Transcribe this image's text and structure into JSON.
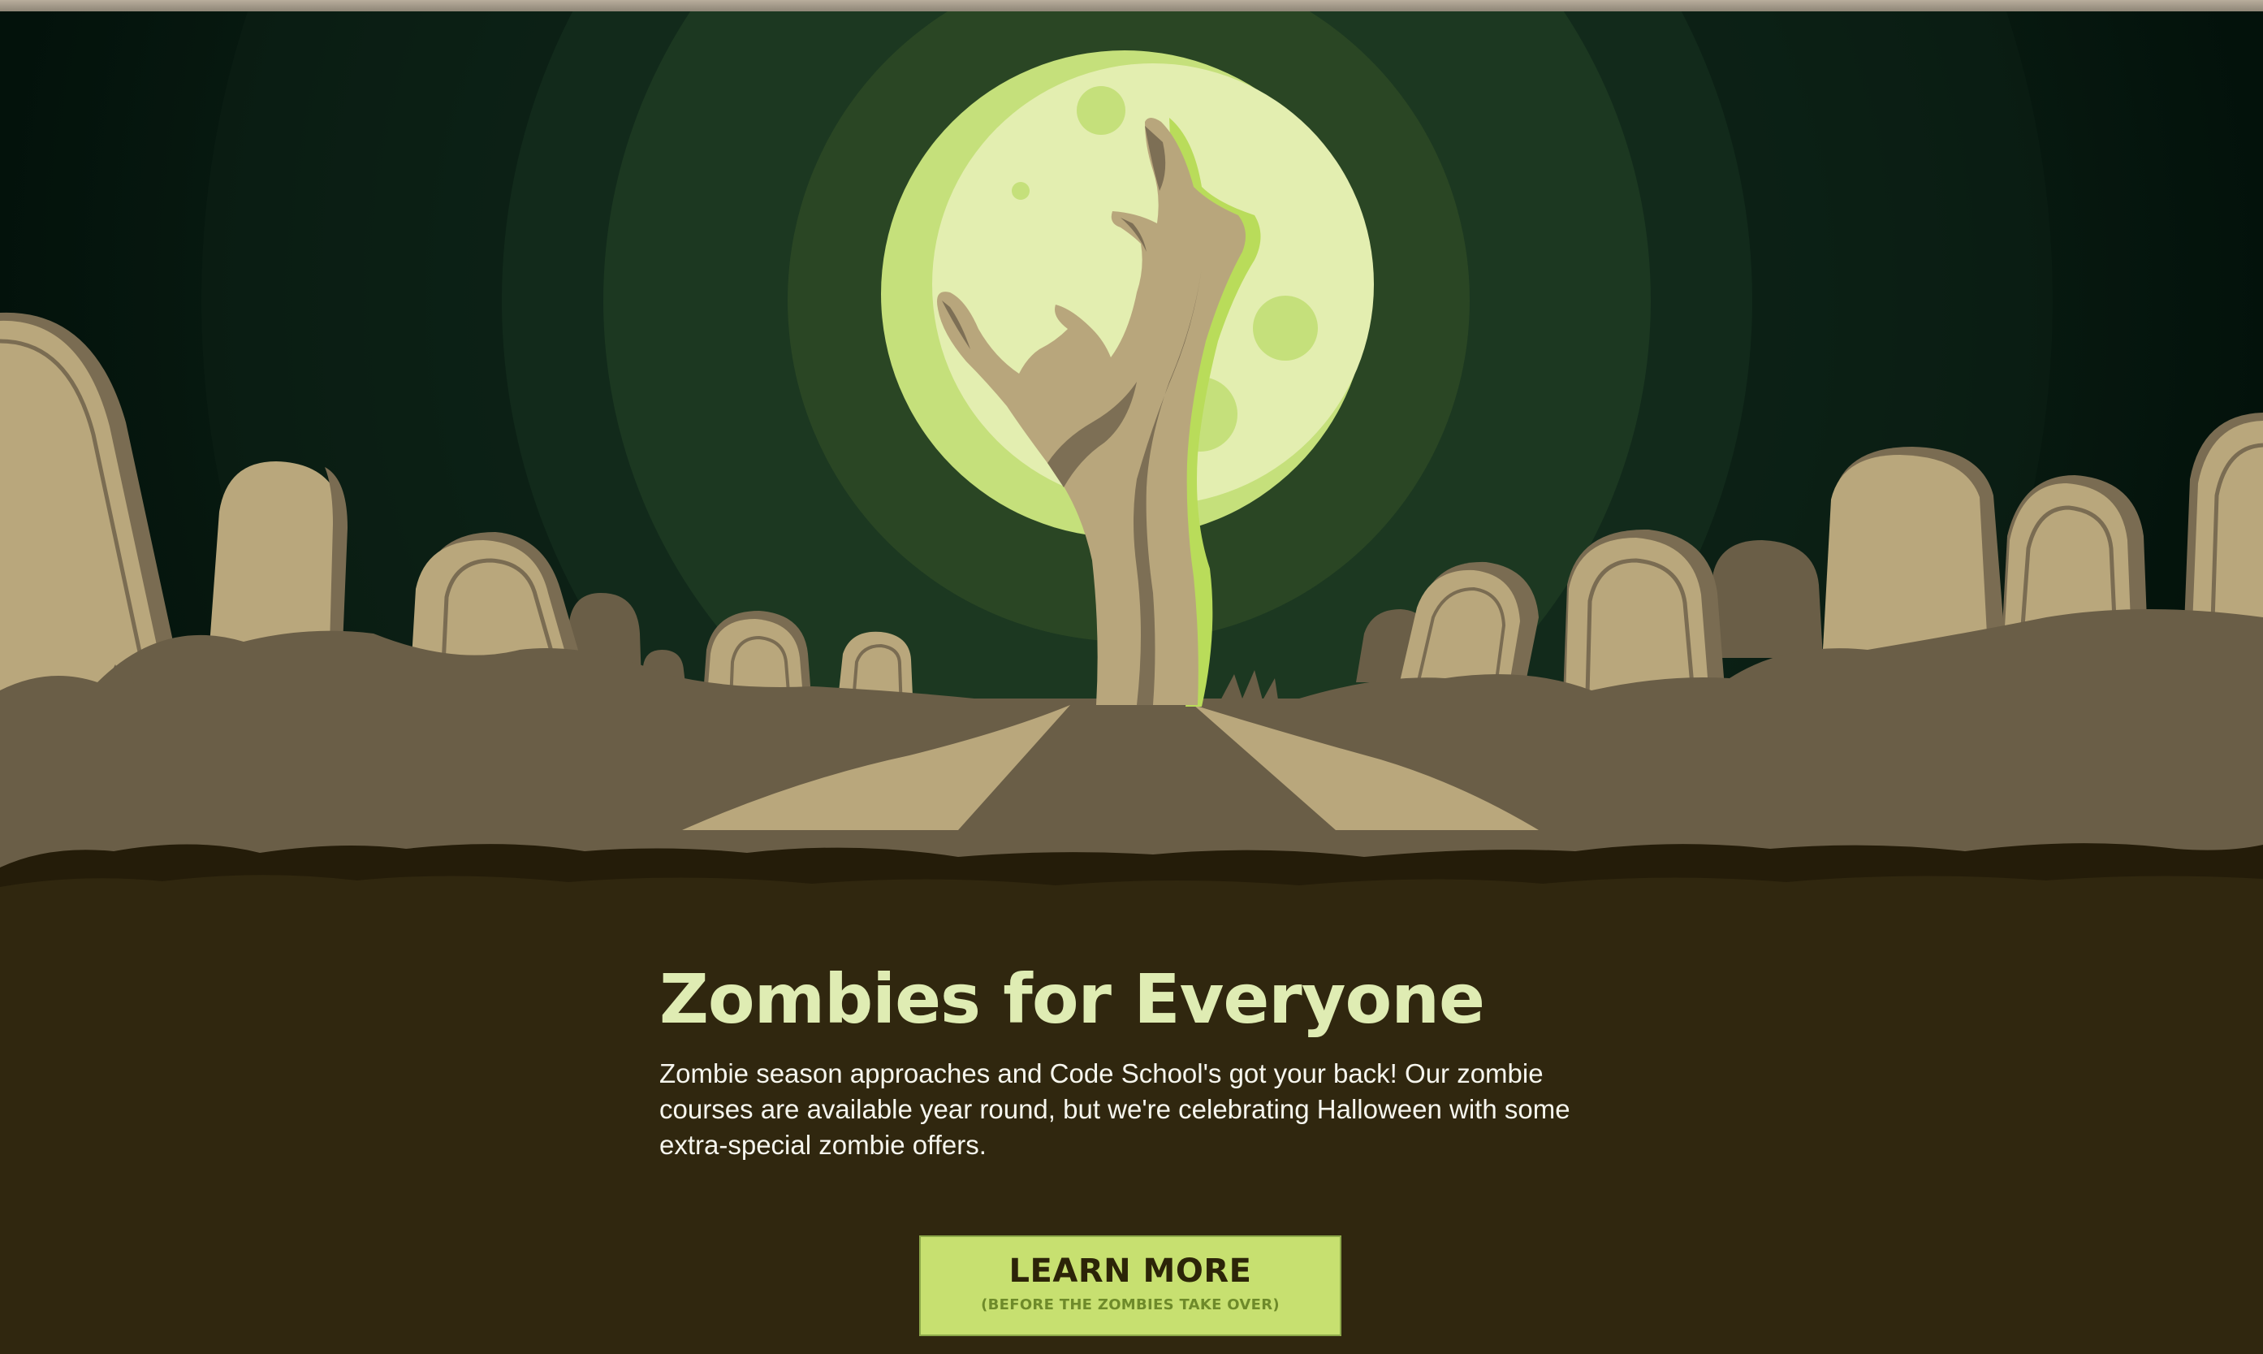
{
  "hero": {
    "illustration": "graveyard-full-moon-zombie-hand",
    "colors": {
      "sky": "#07170f",
      "halo": "#2a4624",
      "moon": "#e3eeb0",
      "moon_crescent": "#c5e07b",
      "hand": "#b8a67c",
      "hand_shadow": "#7d6f55",
      "tombstone": "#b9a77c",
      "ground": "#6a5e47",
      "dirt": "#30270f"
    }
  },
  "content": {
    "headline": "Zombies for Everyone",
    "description": "Zombie season approaches and Code School's got your back! Our zombie courses are available year round, but we're celebrating Halloween with some extra-special zombie offers."
  },
  "cta": {
    "label": "LEARN MORE",
    "sublabel": "(BEFORE THE ZOMBIES TAKE OVER)",
    "color": "#c7e070"
  }
}
